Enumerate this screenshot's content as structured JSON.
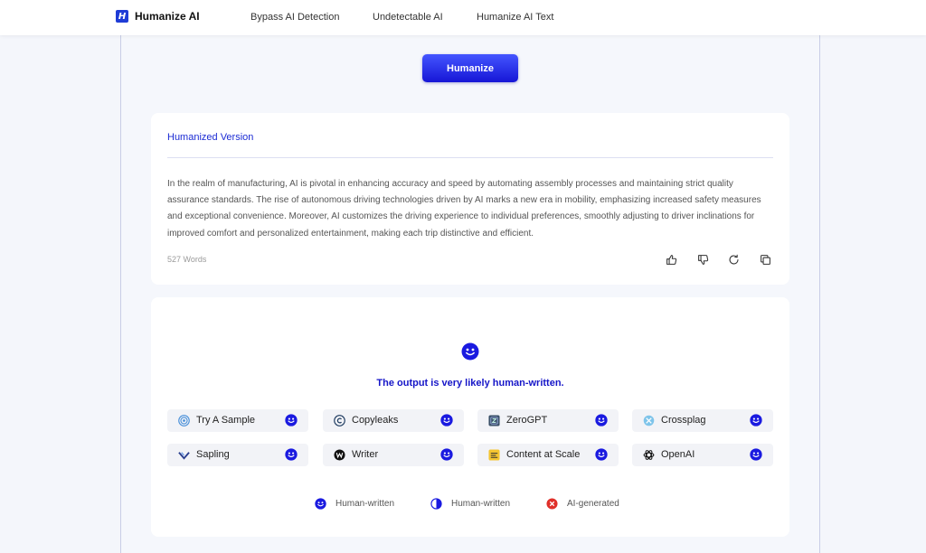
{
  "header": {
    "brand_name": "Humanize AI",
    "nav": [
      "Bypass AI Detection",
      "Undetectable AI",
      "Humanize AI Text"
    ]
  },
  "humanize_button": "Humanize",
  "humanized_card": {
    "title": "Humanized Version",
    "text": "In the realm of manufacturing, AI is pivotal in enhancing accuracy and speed by automating assembly processes and maintaining strict quality assurance standards. The rise of autonomous driving technologies driven by AI marks a new era in mobility, emphasizing increased safety measures and exceptional convenience. Moreover, AI customizes the driving experience to individual preferences, smoothly adjusting to driver inclinations for improved comfort and personalized entertainment, making each trip distinctive and efficient.",
    "word_count": "527 Words",
    "actions": [
      "thumbs-up-icon",
      "thumbs-down-icon",
      "regenerate-icon",
      "copy-icon"
    ]
  },
  "detection_card": {
    "verdict": "The output is very likely human-written.",
    "detectors": [
      {
        "name": "Try A Sample",
        "icon": "spiral-icon",
        "result": "human"
      },
      {
        "name": "Copyleaks",
        "icon": "copyleaks-icon",
        "result": "human"
      },
      {
        "name": "ZeroGPT",
        "icon": "zerogpt-icon",
        "result": "human"
      },
      {
        "name": "Crossplag",
        "icon": "crossplag-icon",
        "result": "human"
      },
      {
        "name": "Sapling",
        "icon": "sapling-icon",
        "result": "human"
      },
      {
        "name": "Writer",
        "icon": "writer-icon",
        "result": "human"
      },
      {
        "name": "Content at Scale",
        "icon": "content-at-scale-icon",
        "result": "human"
      },
      {
        "name": "OpenAI",
        "icon": "openai-icon",
        "result": "human"
      }
    ],
    "legend": [
      {
        "label": "Human-written",
        "icon": "smile-icon"
      },
      {
        "label": "Human-written",
        "icon": "half-circle-icon"
      },
      {
        "label": "AI-generated",
        "icon": "x-circle-icon"
      }
    ]
  },
  "colors": {
    "accent": "#1616d6",
    "human": "#1a1ae0",
    "ai": "#e0302a",
    "page_bg": "#f4f6fb"
  }
}
